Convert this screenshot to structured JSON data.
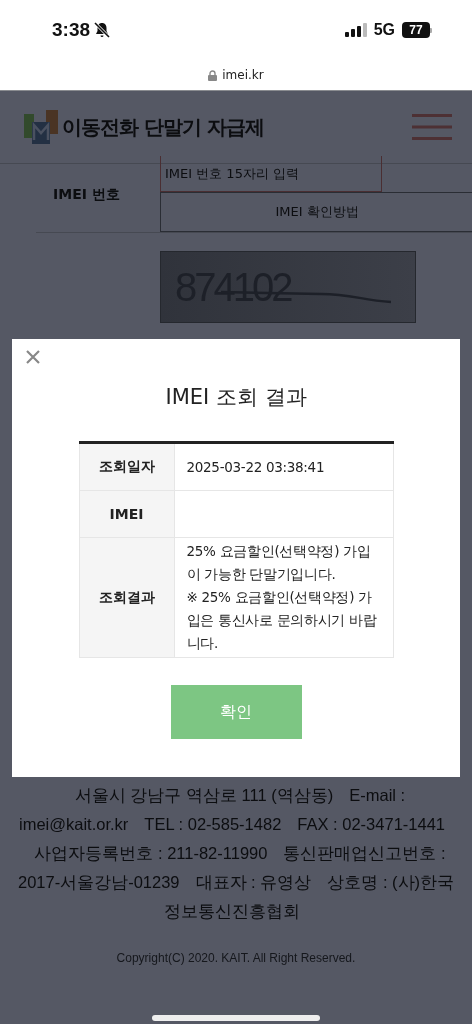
{
  "status_bar": {
    "time": "3:38",
    "network": "5G",
    "battery": "77"
  },
  "browser": {
    "url": "imei.kr"
  },
  "header": {
    "site_title": "이동전화 단말기 자급제"
  },
  "form": {
    "imei_label": "IMEI 번호",
    "imei_placeholder": "IMEI 번호 15자리 입력",
    "help_button": "IMEI 확인방법",
    "captcha": "874102"
  },
  "modal": {
    "title": "IMEI 조회 결과",
    "rows": [
      {
        "label": "조회일자",
        "value": "2025-03-22 03:38:41"
      },
      {
        "label": "IMEI"
      },
      {
        "label": "조회결과",
        "value": "25% 요금할인(선택약정) 가입이 가능한 단말기입니다.\n※ 25% 요금할인(선택약정) 가입은 통신사로 문의하시기 바랍니다."
      }
    ],
    "confirm_button": "확인"
  },
  "footer": {
    "items": [
      "서울시 강남구 역삼로 111 (역삼동)",
      "E-mail : imei@kait.or.kr",
      "TEL : 02-585-1482",
      "FAX : 02-3471-1441",
      "사업자등록번호 : 211-82-11990",
      "통신판매업신고번호 : 2017-서울강남-01239",
      "대표자 : 유영상",
      "상호명 : (사)한국정보통신진흥협회"
    ],
    "copyright": "Copyright(C) 2020. KAIT. All Right Reserved."
  }
}
